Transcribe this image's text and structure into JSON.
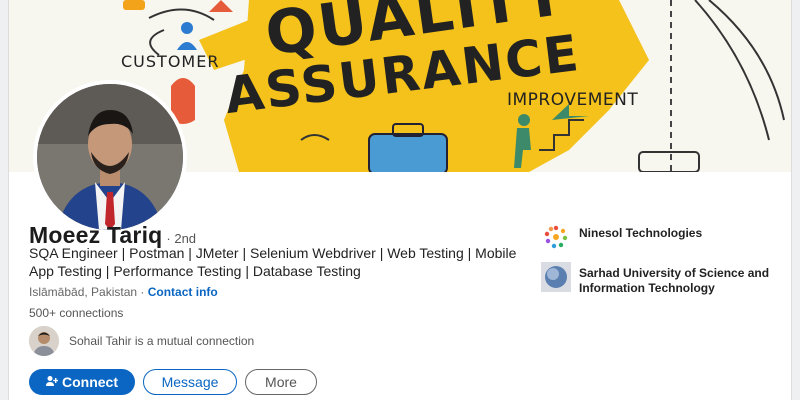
{
  "cover": {
    "customer_text": "CUSTOMER",
    "quality_text": "QUALITY",
    "assurance_text": "ASSURANCE",
    "improvement_text": "IMPROVEMENT"
  },
  "profile": {
    "name": "Moeez Tariq",
    "degree": "· 2nd",
    "headline": "SQA Engineer | Postman | JMeter | Selenium Webdriver | Web Testing | Mobile App Testing | Performance Testing | Database Testing",
    "location": "Islāmābād, Pakistan ·",
    "contact_info": "Contact info",
    "connections": "500+ connections",
    "mutual_text": "Sohail Tahir is a mutual connection"
  },
  "actions": {
    "connect": "Connect",
    "message": "Message",
    "more": "More"
  },
  "sidebar": {
    "items": [
      {
        "label": "Ninesol Technologies",
        "icon": "ninesol-logo"
      },
      {
        "label": "Sarhad University of Science and Information Technology",
        "icon": "university-logo"
      }
    ]
  },
  "colors": {
    "accent": "#0a66c2",
    "cover_yellow": "#f4c21a"
  }
}
